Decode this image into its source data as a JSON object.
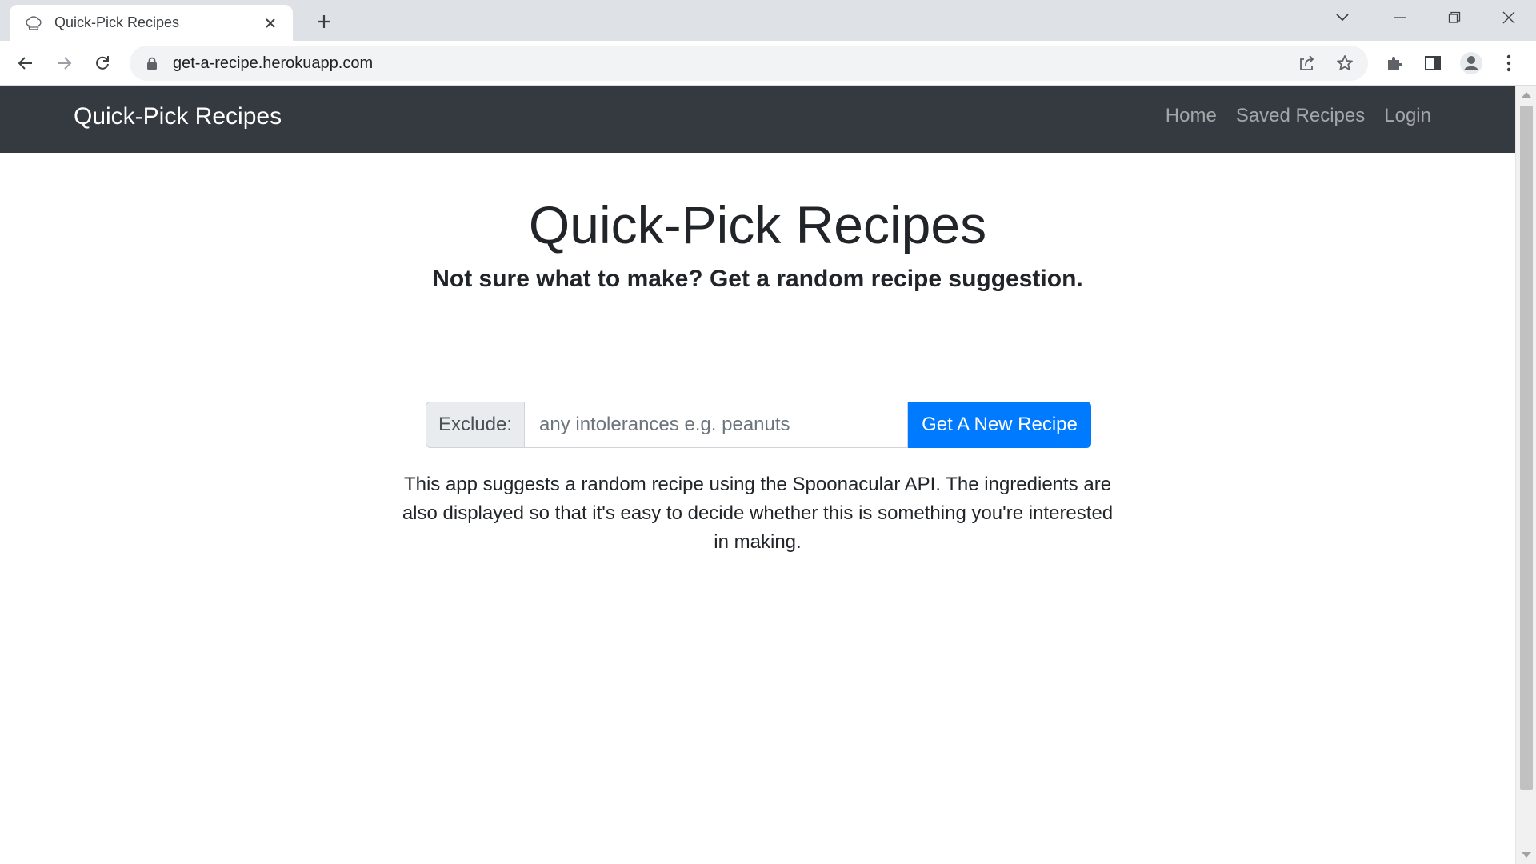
{
  "browser": {
    "tab_title": "Quick-Pick Recipes",
    "url": "get-a-recipe.herokuapp.com",
    "icons": {
      "favicon": "chef-hat-icon",
      "tab_close": "close-icon",
      "new_tab": "plus-icon",
      "tab_search": "chevron-down-icon",
      "minimize": "minimize-icon",
      "restore": "restore-icon",
      "close_window": "close-icon",
      "back": "arrow-left-icon",
      "forward": "arrow-right-icon",
      "reload": "reload-icon",
      "lock": "lock-icon",
      "share": "share-icon",
      "bookmark": "star-icon",
      "extensions": "puzzle-icon",
      "side_panel": "side-panel-icon",
      "profile": "profile-icon",
      "menu": "kebab-menu-icon"
    }
  },
  "navbar": {
    "brand": "Quick-Pick Recipes",
    "links": [
      {
        "label": "Home"
      },
      {
        "label": "Saved Recipes"
      },
      {
        "label": "Login"
      }
    ],
    "background": "#343a40"
  },
  "main": {
    "heading": "Quick-Pick Recipes",
    "subheading": "Not sure what to make? Get a random recipe suggestion.",
    "form": {
      "prepend_label": "Exclude:",
      "input_value": "",
      "input_placeholder": "any intolerances e.g. peanuts",
      "submit_label": "Get A New Recipe",
      "submit_color": "#007bff"
    },
    "description": "This app suggests a random recipe using the Spoonacular API. The ingredients are also displayed so that it's easy to decide whether this is something you're interested in making."
  }
}
